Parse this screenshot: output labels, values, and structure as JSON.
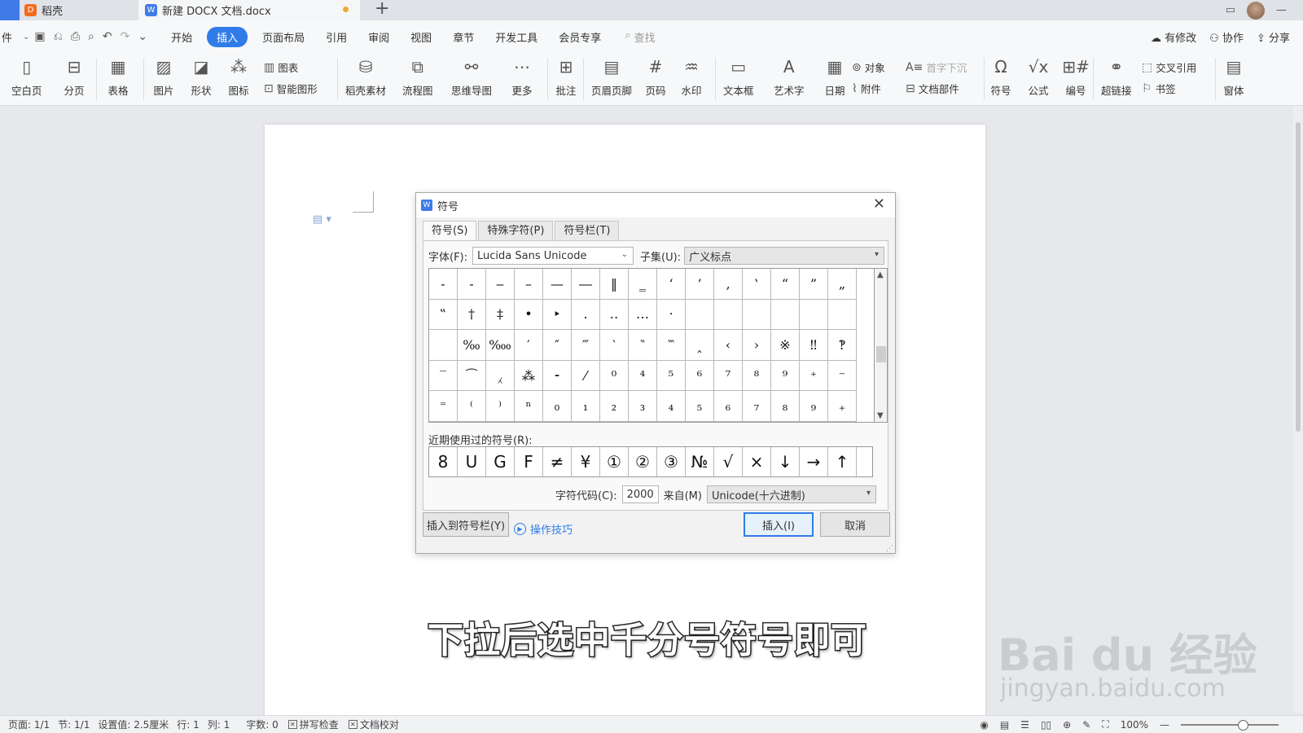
{
  "tabs": [
    {
      "icon": "D",
      "label": "稻壳"
    },
    {
      "icon": "W",
      "label": "新建 DOCX 文档.docx"
    }
  ],
  "new_tab": "+",
  "menu": {
    "file": "件",
    "items": [
      "开始",
      "插入",
      "页面布局",
      "引用",
      "审阅",
      "视图",
      "章节",
      "开发工具",
      "会员专享"
    ],
    "active": "插入",
    "search": "查找",
    "right": [
      "有修改",
      "协作",
      "分享"
    ]
  },
  "ribbon": {
    "blank_page": "空白页",
    "page_break": "分页",
    "table": "表格",
    "picture": "图片",
    "shape": "形状",
    "icon": "图标",
    "chart": "图表",
    "smart_shape": "智能图形",
    "docer": "稻壳素材",
    "flowchart": "流程图",
    "mindmap": "思维导图",
    "more": "更多",
    "comment": "批注",
    "header_footer": "页眉页脚",
    "page_num": "页码",
    "watermark": "水印",
    "textbox": "文本框",
    "wordart": "艺术字",
    "date": "日期",
    "object": "对象",
    "attachment": "附件",
    "dropcap": "首字下沉",
    "doc_parts": "文档部件",
    "symbol": "符号",
    "formula": "公式",
    "numbering": "编号",
    "hyperlink": "超链接",
    "crossref": "交叉引用",
    "bookmark": "书签",
    "window": "窗体"
  },
  "dialog": {
    "title": "符号",
    "close": "✕",
    "tabs": [
      "符号(S)",
      "特殊字符(P)",
      "符号栏(T)"
    ],
    "font_label": "字体(F):",
    "font_value": "Lucida Sans Unicode",
    "subset_label": "子集(U):",
    "subset_value": "广义标点",
    "symbols": [
      [
        "‐",
        "‑",
        "‒",
        "–",
        "—",
        "―",
        "‖",
        "‗",
        "‘",
        "’",
        "‚",
        "‛",
        "“",
        "”",
        "„"
      ],
      [
        "‟",
        "†",
        "‡",
        "•",
        "‣",
        "․",
        "‥",
        "…",
        "‧",
        "",
        "",
        "",
        "",
        "",
        ""
      ],
      [
        "",
        "‰",
        "‱",
        "′",
        "″",
        "‴",
        "‵",
        "‶",
        "‷",
        "‸",
        "‹",
        "›",
        "※",
        "‼",
        "‽"
      ],
      [
        "‾",
        "⁀",
        "⁁",
        "⁂",
        "⁃",
        "⁄",
        "⁰",
        "⁴",
        "⁵",
        "⁶",
        "⁷",
        "⁸",
        "⁹",
        "⁺",
        "⁻"
      ],
      [
        "⁼",
        "⁽",
        "⁾",
        "ⁿ",
        "₀",
        "₁",
        "₂",
        "₃",
        "₄",
        "₅",
        "₆",
        "₇",
        "₈",
        "₉",
        "₊"
      ]
    ],
    "recent_label": "近期使用过的符号(R):",
    "recent": [
      "8",
      "U",
      "G",
      "F",
      "≠",
      "¥",
      "①",
      "②",
      "③",
      "№",
      "√",
      "×",
      "↓",
      "→",
      "↑"
    ],
    "code_label": "字符代码(C):",
    "code_value": "2000",
    "from_label": "来自(M)",
    "from_value": "Unicode(十六进制)",
    "insert_to_bar": "插入到符号栏(Y)",
    "tips": "操作技巧",
    "insert": "插入(I)",
    "cancel": "取消"
  },
  "caption": "下拉后选中千分号符号即可",
  "watermark": {
    "brand": "Bai du 经验",
    "url": "jingyan.baidu.com"
  },
  "status": {
    "page": "页面: 1/1",
    "section": "节: 1/1",
    "setting": "设置值: 2.5厘米",
    "row": "行: 1",
    "col": "列: 1",
    "words": "字数: 0",
    "spell": "拼写检查",
    "proof": "文档校对",
    "zoom": "100%"
  }
}
